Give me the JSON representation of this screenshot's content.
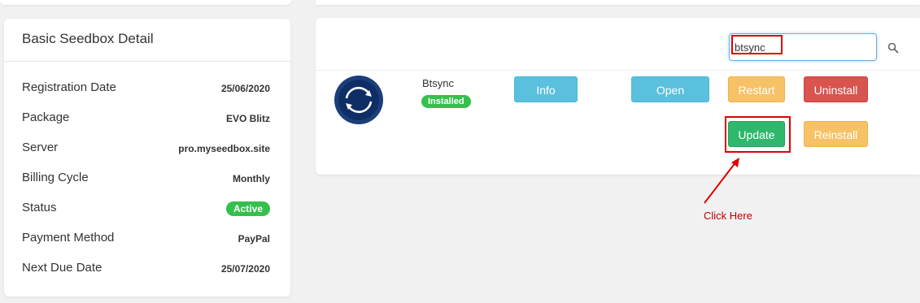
{
  "seedbox_detail": {
    "title": "Basic Seedbox Detail",
    "rows": [
      {
        "label": "Registration Date",
        "value": "25/06/2020"
      },
      {
        "label": "Package",
        "value": "EVO Blitz"
      },
      {
        "label": "Server",
        "value": "pro.myseedbox.site"
      },
      {
        "label": "Billing Cycle",
        "value": "Monthly"
      },
      {
        "label": "Status",
        "value": "Active"
      },
      {
        "label": "Payment Method",
        "value": "PayPal"
      },
      {
        "label": "Next Due Date",
        "value": "25/07/2020"
      }
    ]
  },
  "apps": {
    "search": {
      "value": "btsync",
      "icon": "search-icon"
    },
    "item": {
      "name": "Btsync",
      "status": "Installed",
      "logo_icon": "btsync-logo-icon",
      "buttons": {
        "info": "Info",
        "open": "Open",
        "restart": "Restart",
        "uninstall": "Uninstall",
        "update": "Update",
        "reinstall": "Reinstall"
      }
    }
  },
  "annotation": {
    "text": "Click Here"
  },
  "colors": {
    "info": "#5bc0de",
    "warning": "#f7c266",
    "danger": "#d9534f",
    "success": "#2eb86b",
    "badge": "#35c04e",
    "highlight": "#e00000"
  }
}
